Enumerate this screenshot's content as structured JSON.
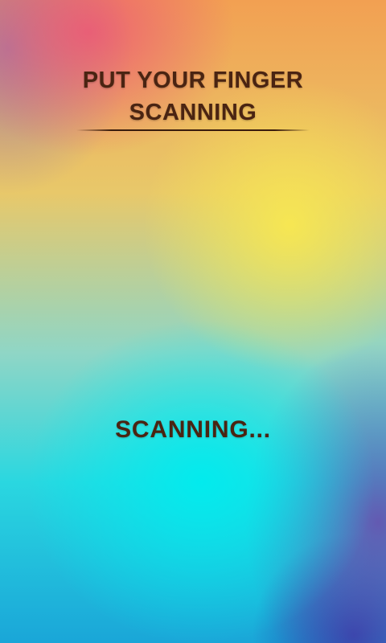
{
  "header": {
    "title_line1": "PUT YOUR FINGER",
    "title_line2": "SCANNING"
  },
  "status": {
    "text": "SCANNING..."
  },
  "colors": {
    "text": "#4a2412",
    "divider": "#3a1c0c"
  }
}
